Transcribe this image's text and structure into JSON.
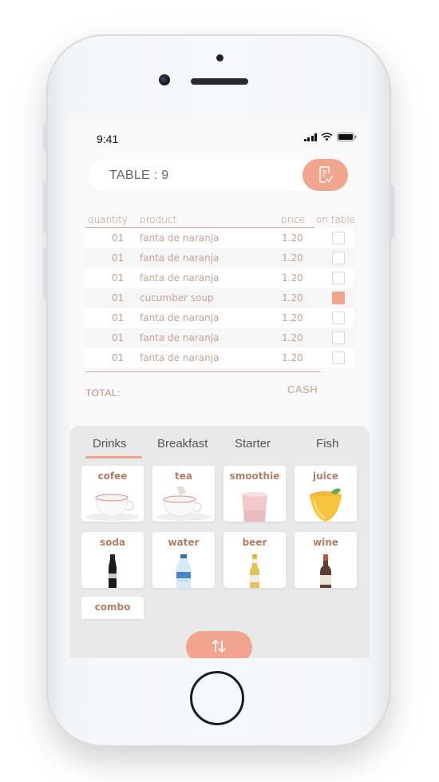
{
  "status_bar": {
    "time": "9:41"
  },
  "header": {
    "table_label": "TABLE : 9",
    "bill_icon": "receipt-check-icon"
  },
  "order": {
    "columns": [
      "quantity",
      "product",
      "price",
      "on table"
    ],
    "rows": [
      {
        "qty": "01",
        "product": "fanta de naranja",
        "price": "1.20",
        "on_table": false
      },
      {
        "qty": "01",
        "product": "fanta de naranja",
        "price": "1.20",
        "on_table": false
      },
      {
        "qty": "01",
        "product": "fanta de naranja",
        "price": "1.20",
        "on_table": false
      },
      {
        "qty": "01",
        "product": "cucumber soup",
        "price": "1.20",
        "on_table": true
      },
      {
        "qty": "01",
        "product": "fanta de naranja",
        "price": "1.20",
        "on_table": false
      },
      {
        "qty": "01",
        "product": "fanta de naranja",
        "price": "1.20",
        "on_table": false
      },
      {
        "qty": "01",
        "product": "fanta de naranja",
        "price": "1.20",
        "on_table": false
      }
    ],
    "total_label": "TOTAL:",
    "payment_label": "CASH"
  },
  "menu": {
    "tabs": [
      "Drinks",
      "Breakfast",
      "Starter",
      "Fish"
    ],
    "active_tab": "Drinks",
    "items": [
      {
        "label": "cofee",
        "icon": "coffee-cup-icon"
      },
      {
        "label": "tea",
        "icon": "tea-cup-icon"
      },
      {
        "label": "smoothie",
        "icon": "smoothie-glass-icon"
      },
      {
        "label": "juice",
        "icon": "juice-glass-icon"
      },
      {
        "label": "soda",
        "icon": "soda-bottle-icon"
      },
      {
        "label": "water",
        "icon": "water-bottle-icon"
      },
      {
        "label": "beer",
        "icon": "beer-bottle-icon"
      },
      {
        "label": "wine",
        "icon": "wine-bottle-icon"
      },
      {
        "label": "combo",
        "icon": ""
      }
    ]
  },
  "swap_button": {
    "icon": "swap-vertical-icon"
  },
  "colors": {
    "accent": "#f2a58e",
    "text_muted": "#c1a395",
    "panel": "#e8e9e8"
  }
}
